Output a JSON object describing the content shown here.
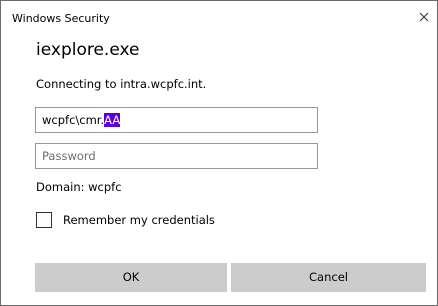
{
  "window": {
    "title": "Windows Security"
  },
  "dialog": {
    "app_name": "iexplore.exe",
    "connecting_message": "Connecting to intra.wcpfc.int.",
    "username": {
      "value_prefix": "wcpfc\\cmr.",
      "value_selected": "AA",
      "selection_color": "#5b00d6"
    },
    "password": {
      "placeholder": "Password"
    },
    "domain_text": "Domain: wcpfc",
    "remember_checkbox": {
      "label": "Remember my credentials",
      "checked": false
    }
  },
  "buttons": {
    "ok_label": "OK",
    "cancel_label": "Cancel"
  },
  "icons": {
    "close": "close-icon"
  },
  "colors": {
    "button_background": "#cccccc",
    "field_border": "#999999",
    "window_border": "#6b6b6b"
  }
}
